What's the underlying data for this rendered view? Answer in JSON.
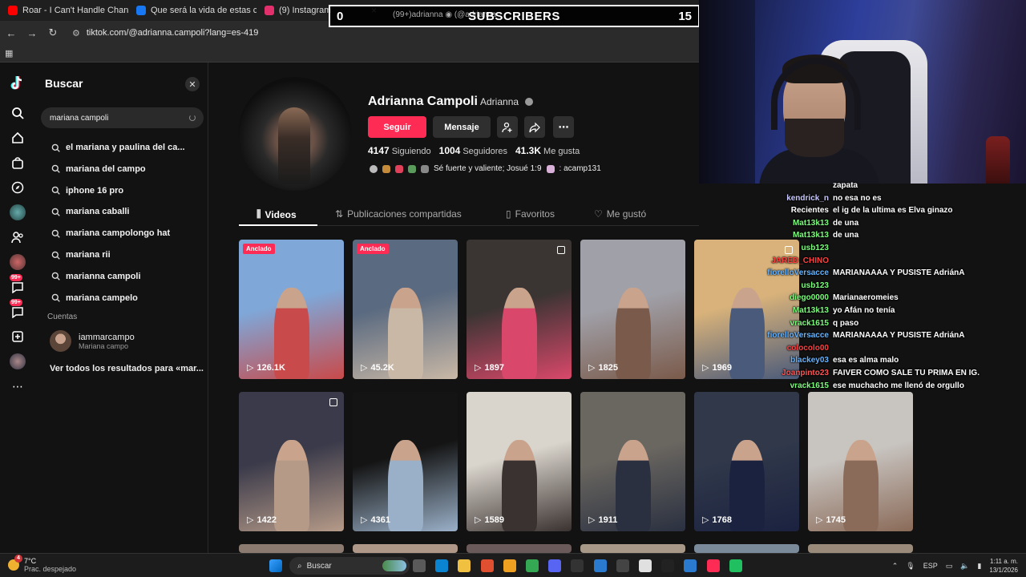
{
  "browser": {
    "tabs": [
      {
        "title": "Roar - I Can't Handle Change ·",
        "color": "#ff0000"
      },
      {
        "title": "Que será la vida de estas chamo",
        "color": "#1877f2"
      },
      {
        "title": "(9) Instagram",
        "color": "#e1306c"
      },
      {
        "title": "(99+)adrianna ◉ (@adrianna",
        "color": "#111111"
      }
    ],
    "url": "tiktok.com/@adrianna.campoli?lang=es-419"
  },
  "search": {
    "title": "Buscar",
    "query": "mariana campoli",
    "suggestions": [
      "el mariana y paulina del ca...",
      "mariana del campo",
      "iphone 16 pro",
      "mariana caballi",
      "mariana campolongo hat",
      "mariana rii",
      "marianna campoli",
      "mariana campelo"
    ],
    "accounts_label": "Cuentas",
    "account": {
      "username": "iammarcampo",
      "name": "Mariana campo"
    },
    "see_all": "Ver todos los resultados para «mar..."
  },
  "rail": {
    "badges": [
      "99+",
      "99+"
    ]
  },
  "profile": {
    "name": "Adrianna Campoli",
    "nickname": "Adrianna",
    "follow_label": "Seguir",
    "message_label": "Mensaje",
    "following_count": "4147",
    "following_label": "Siguiendo",
    "followers_count": "1004",
    "followers_label": "Seguidores",
    "likes_count": "41.3K",
    "likes_label": "Me gusta",
    "bio": "Sé fuerte y valiente; Josué 1:9",
    "bio_tail": ": acamp131",
    "tabs": [
      "Videos",
      "Publicaciones compartidas",
      "Favoritos",
      "Me gustó"
    ],
    "pinned_label": "Anclado",
    "videos": [
      {
        "views": "126.1K",
        "pinned": true,
        "palette": [
          "#7fa7d8",
          "#c84a4a"
        ]
      },
      {
        "views": "45.2K",
        "pinned": true,
        "palette": [
          "#5a6a80",
          "#c9b8a6"
        ]
      },
      {
        "views": "1897",
        "pinned": false,
        "palette": [
          "#3a3433",
          "#d9486a"
        ]
      },
      {
        "views": "1825",
        "pinned": false,
        "palette": [
          "#a0a0a8",
          "#7a5a4a"
        ]
      },
      {
        "views": "1969",
        "pinned": false,
        "palette": [
          "#d8b27a",
          "#4a5a7a"
        ]
      },
      {
        "views": "1422",
        "pinned": false,
        "palette": [
          "#3a3a4a",
          "#b59a88"
        ]
      },
      {
        "views": "4361",
        "pinned": false,
        "palette": [
          "#141414",
          "#9ab0c8"
        ]
      },
      {
        "views": "1589",
        "pinned": false,
        "palette": [
          "#d9d4cc",
          "#3a3230"
        ]
      },
      {
        "views": "1911",
        "pinned": false,
        "palette": [
          "#6a6660",
          "#2a3040"
        ]
      },
      {
        "views": "1768",
        "pinned": false,
        "palette": [
          "#30384a",
          "#1b2240"
        ]
      },
      {
        "views": "1745",
        "pinned": false,
        "palette": [
          "#c8c4c0",
          "#8a6a58"
        ]
      }
    ]
  },
  "overlay": {
    "subscribers_left": "0",
    "subscribers_title": "SUBSCRIBERS",
    "subscribers_right": "15"
  },
  "chat": [
    {
      "user": "",
      "msg": "zapata",
      "color": "#ffffff"
    },
    {
      "user": "kendrick_n",
      "msg": "no esa no es",
      "color": "#c8c8ff"
    },
    {
      "user": "Recientes",
      "msg": "el ig de la ultima es Elva ginazo",
      "color": "#ffffff"
    },
    {
      "user": "Mat13k13",
      "msg": "de una",
      "color": "#7cfc7c"
    },
    {
      "user": "Mat13k13",
      "msg": "de una",
      "color": "#7cfc7c"
    },
    {
      "user": "usb123",
      "msg": "",
      "color": "#7cfc7c"
    },
    {
      "user": "JARED_CHINO",
      "msg": "",
      "color": "#ff4040"
    },
    {
      "user": "fiorelloVersacce",
      "msg": "MARIANAAAA Y PUSISTE AdriánA",
      "color": "#66b3ff"
    },
    {
      "user": "usb123",
      "msg": "",
      "color": "#7cfc7c"
    },
    {
      "user": "diego0000",
      "msg": "Marianaeromeies",
      "color": "#7cfc7c"
    },
    {
      "user": "Mat13k13",
      "msg": "yo Afán no tenía",
      "color": "#7cfc7c"
    },
    {
      "user": "vrack1615",
      "msg": "q paso",
      "color": "#7cfc7c"
    },
    {
      "user": "fiorelloVersacce",
      "msg": "MARIANAAAA Y PUSISTE AdriánA",
      "color": "#66b3ff"
    },
    {
      "user": "colocolo00",
      "msg": "",
      "color": "#ff4040"
    },
    {
      "user": "blackey03",
      "msg": "esa es alma malo",
      "color": "#66b3ff"
    },
    {
      "user": "Joanpinto23",
      "msg": "FAIVER COMO SALE TU PRIMA EN IG.",
      "color": "#ff5555"
    },
    {
      "user": "vrack1615",
      "msg": "ese muchacho me llenó de orgullo",
      "color": "#7cfc7c"
    }
  ],
  "taskbar": {
    "temp": "7°C",
    "weather": "Prac. despejado",
    "search_label": "Buscar",
    "lang": "ESP",
    "time": "1:11 a. m.",
    "date": "13/1/2026",
    "notif": "4"
  }
}
